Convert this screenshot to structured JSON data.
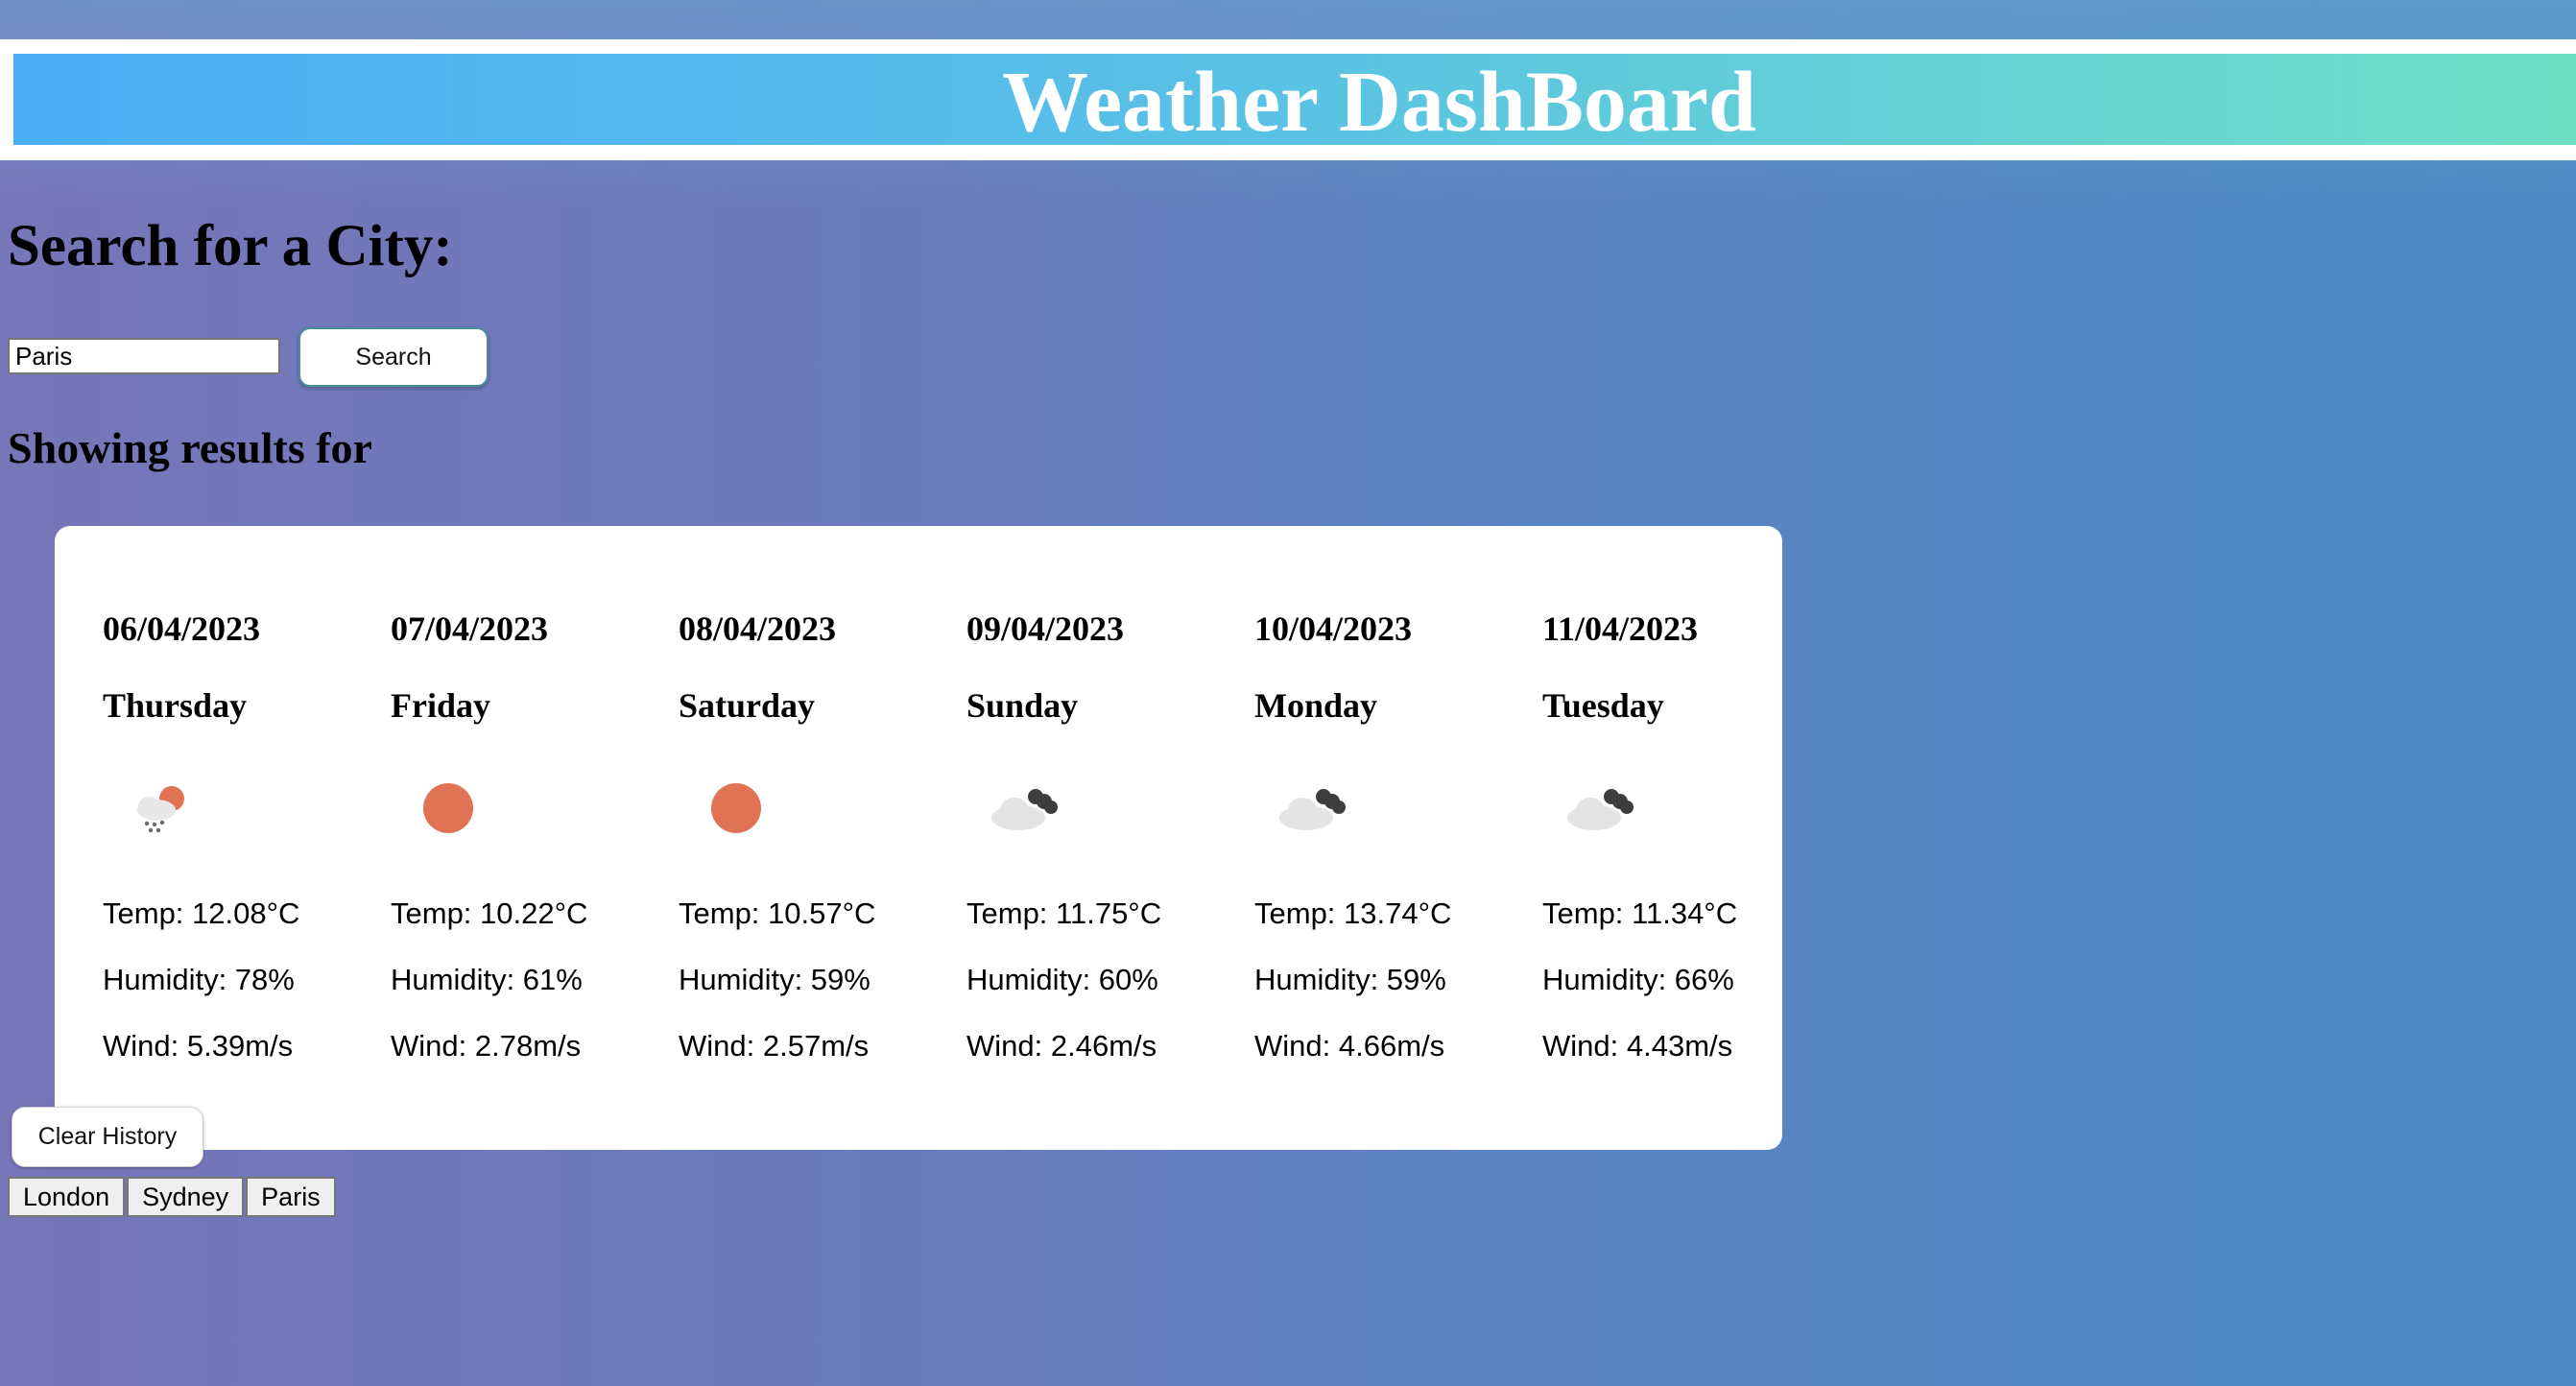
{
  "header": {
    "title": "Weather DashBoard"
  },
  "search": {
    "heading": "Search for a City:",
    "input_value": "Paris",
    "button_label": "Search"
  },
  "results": {
    "heading": "Showing results for"
  },
  "forecast": [
    {
      "date": "06/04/2023",
      "day": "Thursday",
      "icon": "rain-cloud-sun-icon",
      "temp": "Temp: 12.08°C",
      "humidity": "Humidity: 78%",
      "wind": "Wind: 5.39m/s"
    },
    {
      "date": "07/04/2023",
      "day": "Friday",
      "icon": "sun-icon",
      "temp": "Temp: 10.22°C",
      "humidity": "Humidity: 61%",
      "wind": "Wind: 2.78m/s"
    },
    {
      "date": "08/04/2023",
      "day": "Saturday",
      "icon": "sun-icon",
      "temp": "Temp: 10.57°C",
      "humidity": "Humidity: 59%",
      "wind": "Wind: 2.57m/s"
    },
    {
      "date": "09/04/2023",
      "day": "Sunday",
      "icon": "broken-clouds-icon",
      "temp": "Temp: 11.75°C",
      "humidity": "Humidity: 60%",
      "wind": "Wind: 2.46m/s"
    },
    {
      "date": "10/04/2023",
      "day": "Monday",
      "icon": "broken-clouds-icon",
      "temp": "Temp: 13.74°C",
      "humidity": "Humidity: 59%",
      "wind": "Wind: 4.66m/s"
    },
    {
      "date": "11/04/2023",
      "day": "Tuesday",
      "icon": "broken-clouds-icon",
      "temp": "Temp: 11.34°C",
      "humidity": "Humidity: 66%",
      "wind": "Wind: 4.43m/s"
    }
  ],
  "history": {
    "clear_label": "Clear History",
    "cities": [
      "London",
      "Sydney",
      "Paris"
    ]
  },
  "colors": {
    "header_gradient_start": "#4aaef5",
    "header_gradient_end": "#6ee0c6",
    "sun": "#e07356",
    "dark_cloud": "#3d3d3d",
    "light_cloud": "#e2e2e2"
  }
}
